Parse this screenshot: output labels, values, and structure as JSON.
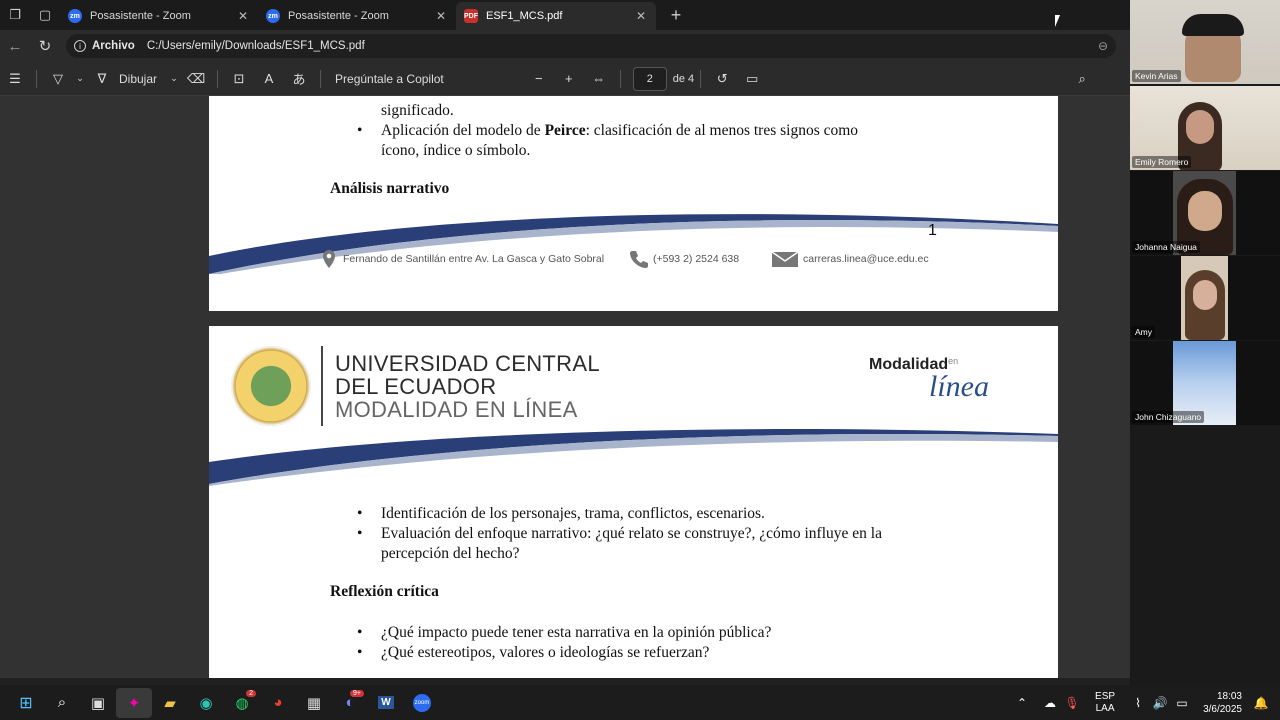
{
  "browser": {
    "tabs": [
      {
        "label": "Posasistente - Zoom",
        "icon": "zoom-icon"
      },
      {
        "label": "Posasistente - Zoom",
        "icon": "zoom-icon"
      },
      {
        "label": "ESF1_MCS.pdf",
        "icon": "pdf-icon"
      }
    ],
    "address": {
      "scheme": "Archivo",
      "url": "C:/Users/emily/Downloads/ESF1_MCS.pdf"
    }
  },
  "pdf_toolbar": {
    "draw_label": "Dibujar",
    "copilot_label": "Pregúntale a Copilot",
    "current_page": "2",
    "page_total": "de 4"
  },
  "document": {
    "page1": {
      "line0": "significado.",
      "bullet1_prefix": "Aplicación del modelo de ",
      "bullet1_bold": "Peirce",
      "bullet1_rest": ": clasificación de al menos tres signos como",
      "bullet1_cont": "ícono, índice o símbolo.",
      "heading": "Análisis narrativo",
      "page_number": "1",
      "footer_address": "Fernando de Santillán entre Av. La Gasca y Gato Sobral",
      "footer_phone": "(+593 2) 2524 638",
      "footer_email": "carreras.linea@uce.edu.ec"
    },
    "page2": {
      "uni_line1": "UNIVERSIDAD CENTRAL",
      "uni_line2": "DEL ECUADOR",
      "uni_line3": "MODALIDAD EN LÍNEA",
      "logo_word1": "Modalidad",
      "logo_word2": "en",
      "logo_word3": "línea",
      "bullet1": "Identificación de los personajes, trama, conflictos, escenarios.",
      "bullet2": "Evaluación del enfoque narrativo: ¿qué relato se construye?, ¿cómo influye en la",
      "bullet2_cont": "percepción del hecho?",
      "heading": "Reflexión crítica",
      "bullet3": "¿Qué impacto puede tener esta narrativa en la opinión pública?",
      "bullet4": "¿Qué estereotipos, valores o ideologías se refuerzan?"
    }
  },
  "participants": [
    {
      "name": "Kevin Arias"
    },
    {
      "name": "Emily Romero"
    },
    {
      "name": "Johanna Naigua"
    },
    {
      "name": "Amy"
    },
    {
      "name": "John Chizaguano"
    }
  ],
  "taskbar": {
    "whatsapp_badge": "2",
    "discord_badge": "9+",
    "lang_line1": "ESP",
    "lang_line2": "LAA",
    "time": "18:03",
    "date": "3/6/2025"
  },
  "colors": {
    "accent_blue": "#2a4e86",
    "zoom_blue": "#2d6cf0",
    "pdf_red": "#c9302c"
  }
}
